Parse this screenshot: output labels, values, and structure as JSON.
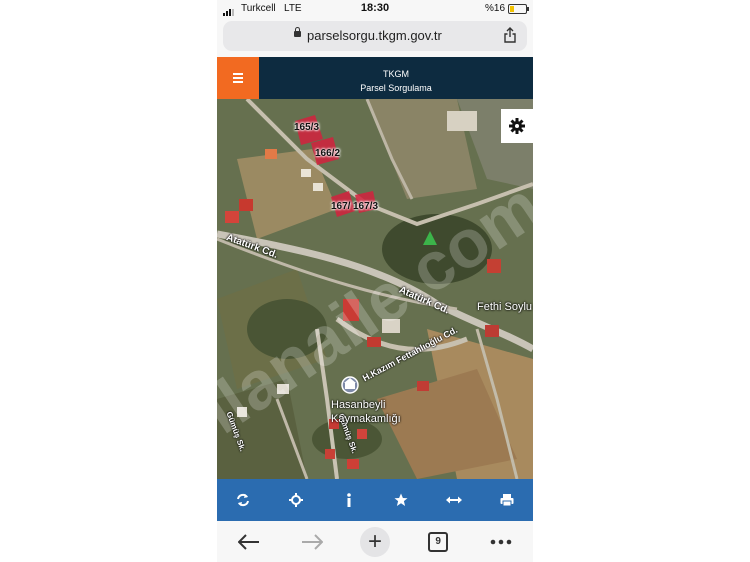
{
  "status_bar": {
    "carrier": "Turkcell",
    "network": "LTE",
    "time": "18:30",
    "battery": "%16"
  },
  "browser": {
    "url": "parselsorgu.tkgm.gov.tr",
    "tab_count": "9"
  },
  "app": {
    "title": "TKGM",
    "subtitle": "Parsel Sorgulama"
  },
  "map": {
    "parcels": [
      "165/3",
      "166/2",
      "167/3"
    ],
    "parcel_167_prefix": "167/",
    "streets": [
      "Atatürk Cd.",
      "Atatürk Cd.",
      "H.Kazım Fettahlıoğlu Cd.",
      "Gümüş Sk.",
      "Gümüş Sk."
    ],
    "pois": [
      "Fethi Soylu",
      "Hasanbeyli",
      "Kaymakamlığı"
    ],
    "watermark": "ilanaile.com"
  },
  "toolbar": {
    "buttons": [
      "refresh-icon",
      "locate-icon",
      "info-icon",
      "star-icon",
      "measure-icon",
      "print-icon"
    ]
  },
  "colors": {
    "header_bg": "#0d2b40",
    "menu_accent": "#f26a21",
    "toolbar_bg": "#2b6cb0",
    "parcel_fill": "#d4213d"
  }
}
